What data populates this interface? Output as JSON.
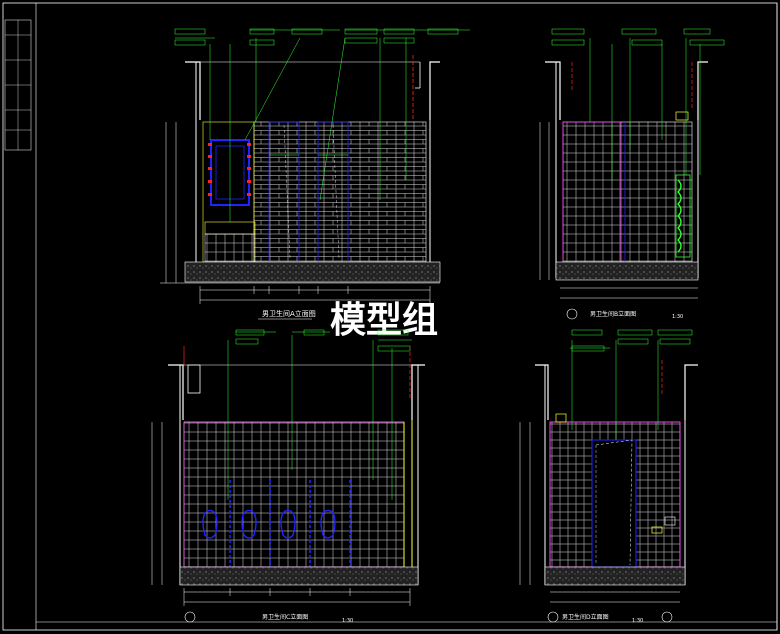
{
  "watermark": "模型组",
  "drawings": {
    "A": {
      "title": "男卫生间A立面图",
      "scale": "1:30"
    },
    "B": {
      "title": "男卫生间B立面图",
      "scale": "1:30"
    },
    "C": {
      "title": "男卫生间C立面图",
      "scale": "1:30"
    },
    "D": {
      "title": "男卫生间D立面图",
      "scale": "1:30"
    }
  },
  "colors": {
    "background": "#000000",
    "frame": "#ffffff",
    "leader": "#33ff33",
    "tile": "#ffffff",
    "accent_blue": "#2222ff",
    "accent_magenta": "#ff33ff",
    "accent_red": "#ff2222",
    "accent_yellow": "#ffff33",
    "dimension": "#ffffff"
  }
}
